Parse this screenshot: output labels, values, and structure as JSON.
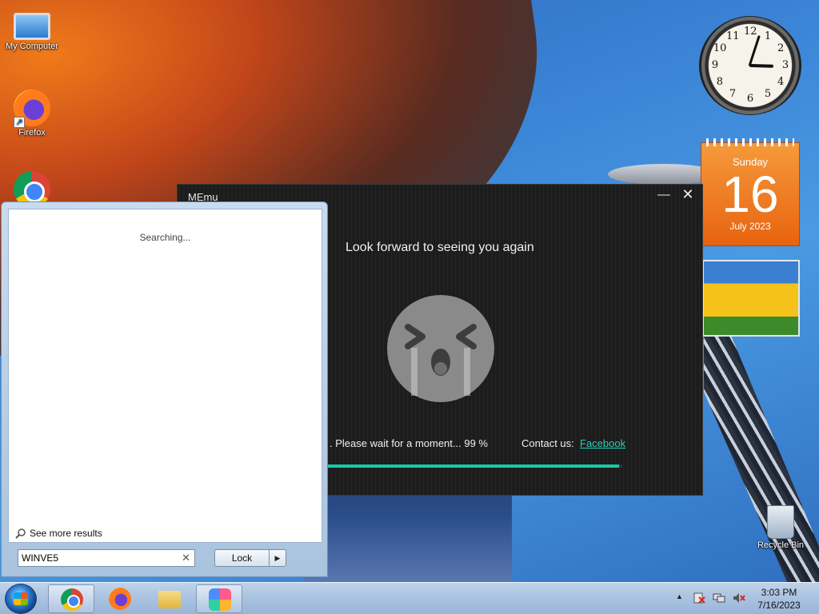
{
  "desktop": {
    "icons": [
      {
        "label": "My Computer",
        "icon": "computer-icon"
      },
      {
        "label": "Firefox",
        "icon": "firefox-icon"
      },
      {
        "label": "",
        "icon": "chrome-icon"
      },
      {
        "label": "Recycle Bin",
        "icon": "recycle-bin-icon"
      }
    ]
  },
  "gadgets": {
    "clock": {
      "numbers": [
        "12",
        "1",
        "2",
        "3",
        "4",
        "5",
        "6",
        "7",
        "8",
        "9",
        "10",
        "11"
      ],
      "hour": 3,
      "minute": 3
    },
    "calendar": {
      "day_name": "Sunday",
      "date": "16",
      "month_year": "July 2023"
    }
  },
  "memu": {
    "title": "MEmu",
    "min_icon": "minimize-icon",
    "close_icon": "close-icon",
    "heading": "Look forward to seeing you again",
    "status": ". Please wait for a moment...   99 %",
    "progress": 0.99,
    "contact_label": "Contact us:",
    "link_text": "Facebook"
  },
  "start_menu": {
    "searching": "Searching...",
    "see_more": "See more results",
    "search_value": "WINVE5",
    "lock_label": "Lock"
  },
  "taskbar": {
    "time": "3:03 PM",
    "date": "7/16/2023",
    "apps": [
      "chrome-icon",
      "firefox-icon",
      "folder-icon",
      "memu-icon"
    ]
  },
  "colors": {
    "accent": "#17c9a7",
    "link": "#26d0b6",
    "calendar": "#e8630f"
  }
}
